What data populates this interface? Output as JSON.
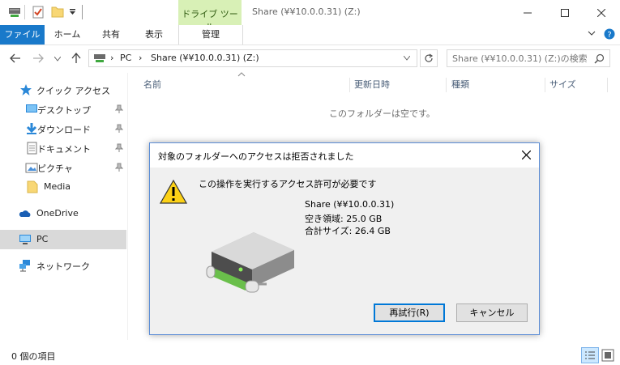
{
  "titlebar": {
    "context_tab": "ドライブ ツール",
    "title": "Share (¥¥10.0.0.31) (Z:)"
  },
  "ribbon": {
    "tabs": [
      "ファイル",
      "ホーム",
      "共有",
      "表示",
      "管理"
    ]
  },
  "address": {
    "pc": "PC",
    "drive": "Share (¥¥10.0.0.31) (Z:)"
  },
  "search": {
    "placeholder": "Share (¥¥10.0.0.31) (Z:)の検索"
  },
  "nav": {
    "quick_access": "クイック アクセス",
    "items": [
      "デスクトップ",
      "ダウンロード",
      "ドキュメント",
      "ピクチャ",
      "Media"
    ],
    "onedrive": "OneDrive",
    "pc": "PC",
    "network": "ネットワーク"
  },
  "columns": [
    "名前",
    "更新日時",
    "種類",
    "サイズ"
  ],
  "empty_message": "このフォルダーは空です。",
  "status": "0 個の項目",
  "dialog": {
    "title": "対象のフォルダーへのアクセスは拒否されました",
    "message": "この操作を実行するアクセス許可が必要です",
    "drive_name": "Share (¥¥10.0.0.31)",
    "free_space": "空き領域: 25.0 GB",
    "total_size": "合計サイズ: 26.4 GB",
    "retry_label": "再試行(R)",
    "cancel_label": "キャンセル"
  },
  "colors": {
    "accent": "#1979ca",
    "context_tab": "#d8f0b6",
    "selection": "#d9d9d9",
    "dialog_border": "#5b8dd6"
  }
}
